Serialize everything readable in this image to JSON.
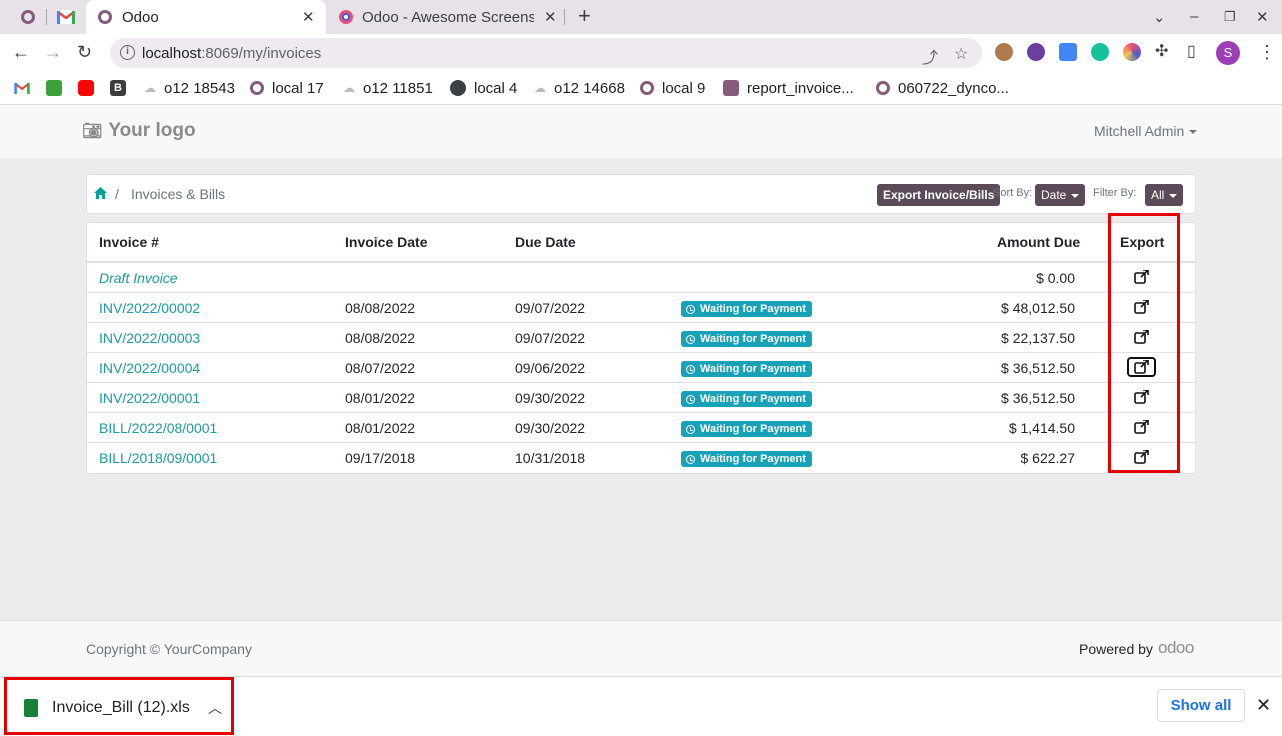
{
  "browser": {
    "tabs": [
      {
        "title": "",
        "icon": "odoo-icon"
      },
      {
        "title": "",
        "icon": "gmail-icon"
      },
      {
        "title": "Odoo",
        "icon": "odoo-icon",
        "active": true
      },
      {
        "title": "Odoo - Awesome Screensh",
        "icon": "awesome-screenshot-icon"
      }
    ],
    "url_host": "localhost",
    "url_path": ":8069/my/invoices",
    "profile_initial": "S",
    "bookmarks": [
      {
        "label": "",
        "icon": "gmail-icon"
      },
      {
        "label": "",
        "icon": "green-extension-icon"
      },
      {
        "label": "",
        "icon": "youtube-icon"
      },
      {
        "label": "",
        "icon": "bootstrap-icon"
      },
      {
        "label": "o12 18543",
        "icon": "cloud-icon"
      },
      {
        "label": "local 17",
        "icon": "odoo-icon"
      },
      {
        "label": "o12 11851",
        "icon": "cloud-icon"
      },
      {
        "label": "local 4",
        "icon": "globe-icon"
      },
      {
        "label": "o12 14668",
        "icon": "cloud-icon"
      },
      {
        "label": "local 9",
        "icon": "odoo-icon"
      },
      {
        "label": "report_invoice...",
        "icon": "odoo-square-icon"
      },
      {
        "label": "060722_dynco...",
        "icon": "odoo-icon"
      }
    ]
  },
  "header": {
    "logo_text": "Your logo",
    "user_name": "Mitchell Admin"
  },
  "breadcrumb": {
    "title": "Invoices & Bills"
  },
  "controls": {
    "export_label": "Export Invoice/Bills",
    "sort_label": "Sort By:",
    "sort_value": "Date",
    "filter_label": "Filter By:",
    "filter_value": "All"
  },
  "table": {
    "columns": [
      "Invoice #",
      "Invoice Date",
      "Due Date",
      "Amount Due",
      "Export"
    ],
    "rows": [
      {
        "number": "Draft Invoice",
        "invoice_date": "",
        "due_date": "",
        "status": "",
        "amount": "$ 0.00",
        "draft": true
      },
      {
        "number": "INV/2022/00002",
        "invoice_date": "08/08/2022",
        "due_date": "09/07/2022",
        "status": "Waiting for Payment",
        "amount": "$ 48,012.50"
      },
      {
        "number": "INV/2022/00003",
        "invoice_date": "08/08/2022",
        "due_date": "09/07/2022",
        "status": "Waiting for Payment",
        "amount": "$ 22,137.50"
      },
      {
        "number": "INV/2022/00004",
        "invoice_date": "08/07/2022",
        "due_date": "09/06/2022",
        "status": "Waiting for Payment",
        "amount": "$ 36,512.50",
        "export_focused": true
      },
      {
        "number": "INV/2022/00001",
        "invoice_date": "08/01/2022",
        "due_date": "09/30/2022",
        "status": "Waiting for Payment",
        "amount": "$ 36,512.50"
      },
      {
        "number": "BILL/2022/08/0001",
        "invoice_date": "08/01/2022",
        "due_date": "09/30/2022",
        "status": "Waiting for Payment",
        "amount": "$ 1,414.50"
      },
      {
        "number": "BILL/2018/09/0001",
        "invoice_date": "09/17/2018",
        "due_date": "10/31/2018",
        "status": "Waiting for Payment",
        "amount": "$ 622.27"
      }
    ]
  },
  "footer": {
    "copyright": "Copyright © YourCompany",
    "powered_by": "Powered by",
    "brand": "odoo"
  },
  "downloads": {
    "file_name": "Invoice_Bill (12).xls",
    "show_all_label": "Show all"
  },
  "colors": {
    "accent_teal": "#00a09d",
    "link": "#1b9a9f",
    "badge": "#17a2b8",
    "button_dark": "#5b4a58",
    "highlight_red": "#e60000",
    "odoo_purple": "#875a7b"
  }
}
